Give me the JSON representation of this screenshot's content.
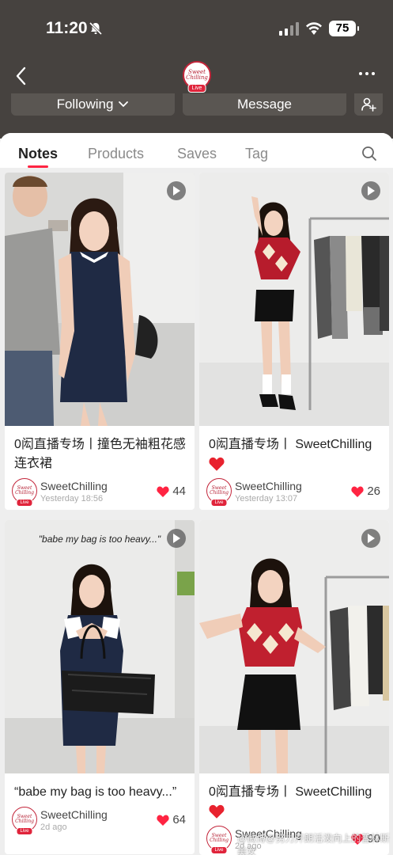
{
  "status_bar": {
    "time": "11:20",
    "battery": "75"
  },
  "header": {
    "logo_text": "Sweet Chilling",
    "live_label": "Live"
  },
  "actions": {
    "following_label": "Following",
    "message_label": "Message"
  },
  "tabs": [
    "Notes",
    "Products",
    "Saves",
    "Tag"
  ],
  "active_tab": "Notes",
  "colors": {
    "accent": "#ff2442",
    "header_bg": "#46423f",
    "heart": "#ff2442"
  },
  "posts": [
    {
      "title": "0闳直播专场丨撞色无袖粗花感连衣裙",
      "author": "SweetChilling",
      "time": "Yesterday 18:56",
      "likes": "44"
    },
    {
      "title": "0闳直播专场丨 SweetChilling",
      "emoji": "heart",
      "author": "SweetChilling",
      "time": "Yesterday 13:07",
      "likes": "26"
    },
    {
      "overlay_caption": "\"babe my bag is too heavy...\"",
      "title": "“babe my bag is too heavy...”",
      "author": "SweetChilling",
      "time": "2d ago",
      "likes": "64"
    },
    {
      "title": "0闳直播专场丨 SweetChilling",
      "emoji": "heart",
      "author": "SweetChilling",
      "time": "2d ago",
      "likes": "90"
    }
  ],
  "watermark": "@微博@努力开朗活泼向上的普林斯美女"
}
